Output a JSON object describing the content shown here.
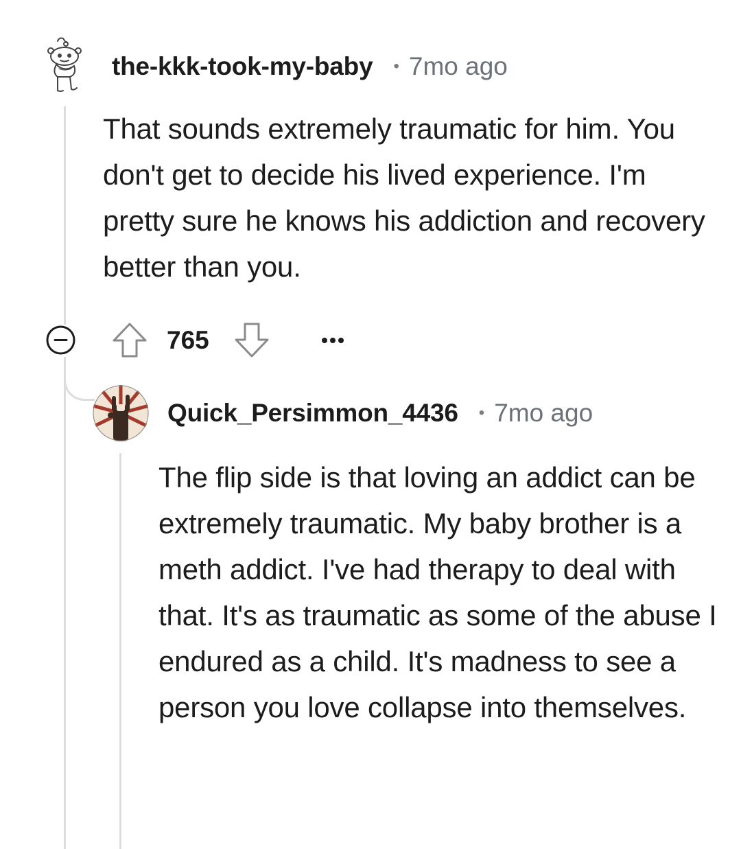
{
  "comment": {
    "username": "the-kkk-took-my-baby",
    "separator": "•",
    "timestamp": "7mo ago",
    "body": "That sounds extremely traumatic for him. You don't get to decide his lived experience. I'm pretty sure he knows his addiction and recovery better than you.",
    "score": "765",
    "icons": {
      "collapse": "minus-circle-icon",
      "upvote": "arrow-up-icon",
      "downvote": "arrow-down-icon",
      "more": "more-horizontal-icon"
    }
  },
  "reply": {
    "username": "Quick_Persimmon_4436",
    "separator": "•",
    "timestamp": "7mo ago",
    "body": "The flip side is that loving an addict can be extremely traumatic. My baby brother is a meth addict. I've had therapy to deal with that. It's as traumatic as some of the abuse I endured as a child. It's madness to see a person you love collapse into themselves."
  },
  "colors": {
    "text": "#1c1c1c",
    "meta": "#6a7178",
    "thread_line": "#dcdcdc",
    "avatar_accent": "#a33a2b"
  }
}
